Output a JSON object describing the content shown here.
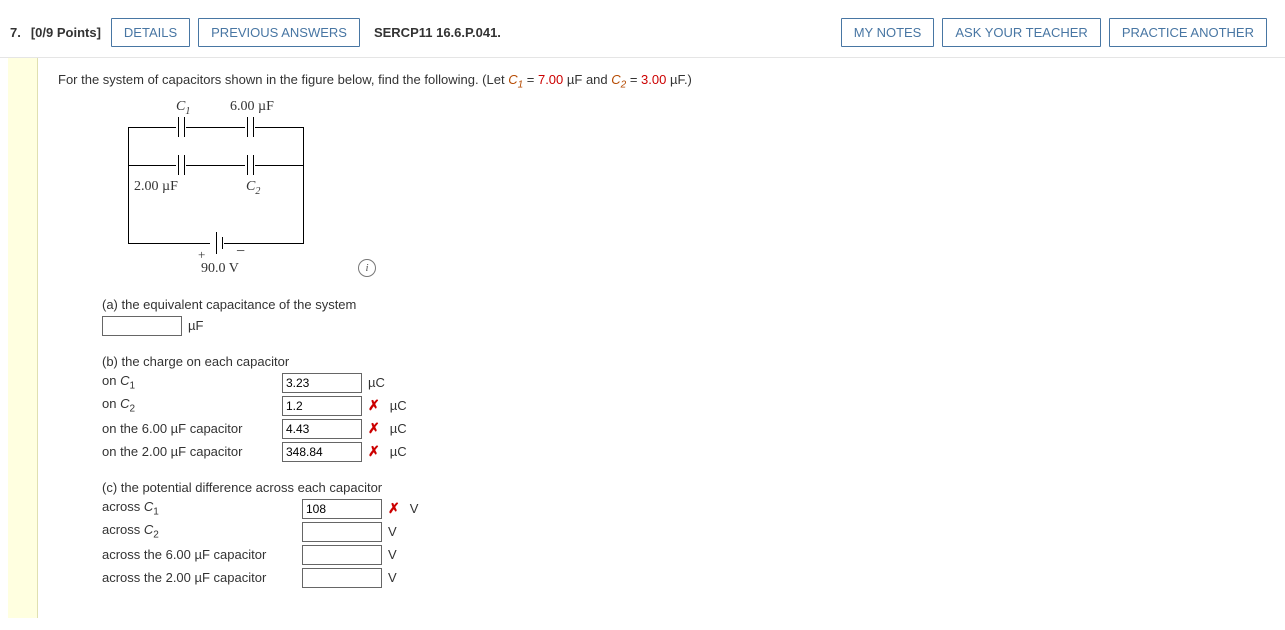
{
  "header": {
    "qnum": "7.",
    "points": "[0/9 Points]",
    "details": "DETAILS",
    "prev": "PREVIOUS ANSWERS",
    "ref": "SERCP11 16.6.P.041.",
    "notes": "MY NOTES",
    "ask": "ASK YOUR TEACHER",
    "practice": "PRACTICE ANOTHER"
  },
  "stem": {
    "pre": "For the system of capacitors shown in the figure below, find the following. (Let ",
    "c1var": "C",
    "c1sub": "1",
    "eq1": " = ",
    "c1val": "7.00",
    "mu": " µF",
    "and": " and ",
    "c2var": "C",
    "c2sub": "2",
    "eq2": " = ",
    "c2val": "3.00",
    "post": " µF.)"
  },
  "circuit": {
    "c1": "C",
    "c1s": "1",
    "cap6": "6.00 µF",
    "cap2": "2.00 µF",
    "c2": "C",
    "c2s": "2",
    "plus": "+",
    "minus": "−",
    "volt": "90.0 V"
  },
  "info": "i",
  "a": {
    "title": "(a) the equivalent capacitance of the system",
    "val": "",
    "unit": "µF"
  },
  "b": {
    "title": "(b) the charge on each capacitor",
    "rows": [
      {
        "label_pre": "on ",
        "label_var": "C",
        "label_sub": "1",
        "val": "3.23",
        "mark": "",
        "unit": "µC"
      },
      {
        "label_pre": "on ",
        "label_var": "C",
        "label_sub": "2",
        "val": "1.2",
        "mark": "✗",
        "unit": "µC"
      },
      {
        "label_pre": "on the 6.00 µF capacitor",
        "label_var": "",
        "label_sub": "",
        "val": "4.43",
        "mark": "✗",
        "unit": "µC"
      },
      {
        "label_pre": "on the 2.00 µF capacitor",
        "label_var": "",
        "label_sub": "",
        "val": "348.84",
        "mark": "✗",
        "unit": "µC"
      }
    ]
  },
  "c": {
    "title": "(c) the potential difference across each capacitor",
    "rows": [
      {
        "label_pre": "across ",
        "label_var": "C",
        "label_sub": "1",
        "val": "108",
        "mark": "✗",
        "unit": "V"
      },
      {
        "label_pre": "across ",
        "label_var": "C",
        "label_sub": "2",
        "val": "",
        "mark": "",
        "unit": "V"
      },
      {
        "label_pre": "across the 6.00 µF capacitor",
        "label_var": "",
        "label_sub": "",
        "val": "",
        "mark": "",
        "unit": "V"
      },
      {
        "label_pre": "across the 2.00 µF capacitor",
        "label_var": "",
        "label_sub": "",
        "val": "",
        "mark": "",
        "unit": "V"
      }
    ]
  }
}
